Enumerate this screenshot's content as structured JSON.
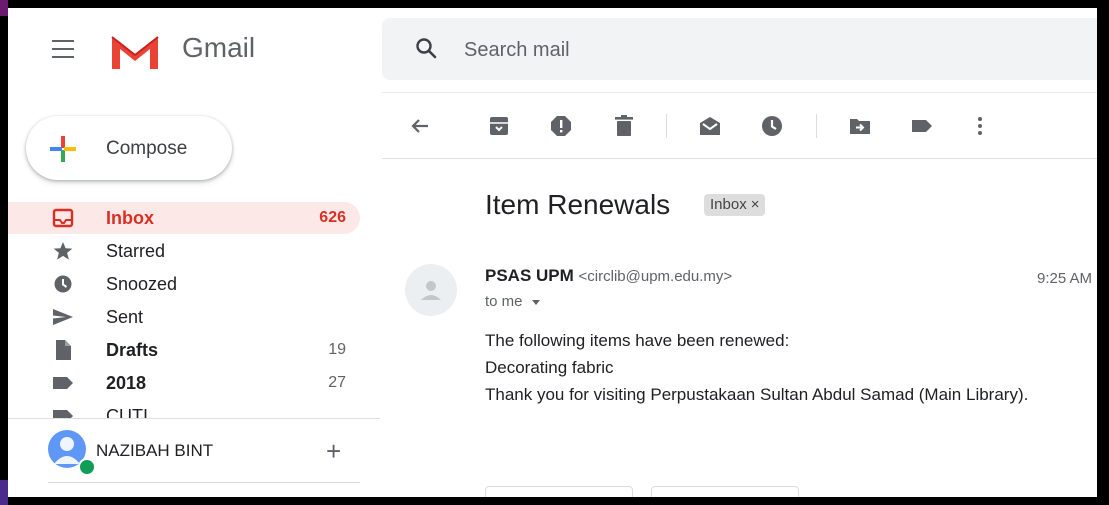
{
  "app": {
    "name": "Gmail"
  },
  "colors": {
    "accent": "#d93025",
    "active_bg": "#fce8e6",
    "online": "#0f9d58"
  },
  "search": {
    "placeholder": "Search mail"
  },
  "compose": {
    "label": "Compose"
  },
  "sidebar": {
    "items": [
      {
        "label": "Inbox",
        "count": "626",
        "icon": "inbox-icon",
        "active": true
      },
      {
        "label": "Starred",
        "count": "",
        "icon": "star-icon"
      },
      {
        "label": "Snoozed",
        "count": "",
        "icon": "clock-icon"
      },
      {
        "label": "Sent",
        "count": "",
        "icon": "send-icon"
      },
      {
        "label": "Drafts",
        "count": "19",
        "icon": "draft-icon",
        "bold": true
      },
      {
        "label": "2018",
        "count": "27",
        "icon": "label-icon",
        "bold": true
      },
      {
        "label": "CUTI",
        "count": "",
        "icon": "label-icon"
      }
    ]
  },
  "account": {
    "name": "NAZIBAH BINT"
  },
  "toolbar": {
    "icons": [
      "back-arrow-icon",
      "archive-icon",
      "report-spam-icon",
      "delete-icon",
      "mark-unread-icon",
      "snooze-icon",
      "move-to-icon",
      "labels-icon",
      "more-vert-icon"
    ]
  },
  "email": {
    "subject": "Item Renewals",
    "label": "Inbox",
    "label_close": "×",
    "sender_name": "PSAS UPM",
    "sender_email": "<circlib@upm.edu.my>",
    "to": "to me",
    "time": "9:25 AM",
    "body": [
      "The following items have been renewed:",
      "Decorating fabric",
      "Thank you for visiting Perpustakaan Sultan Abdul Samad (Main Library)."
    ]
  }
}
